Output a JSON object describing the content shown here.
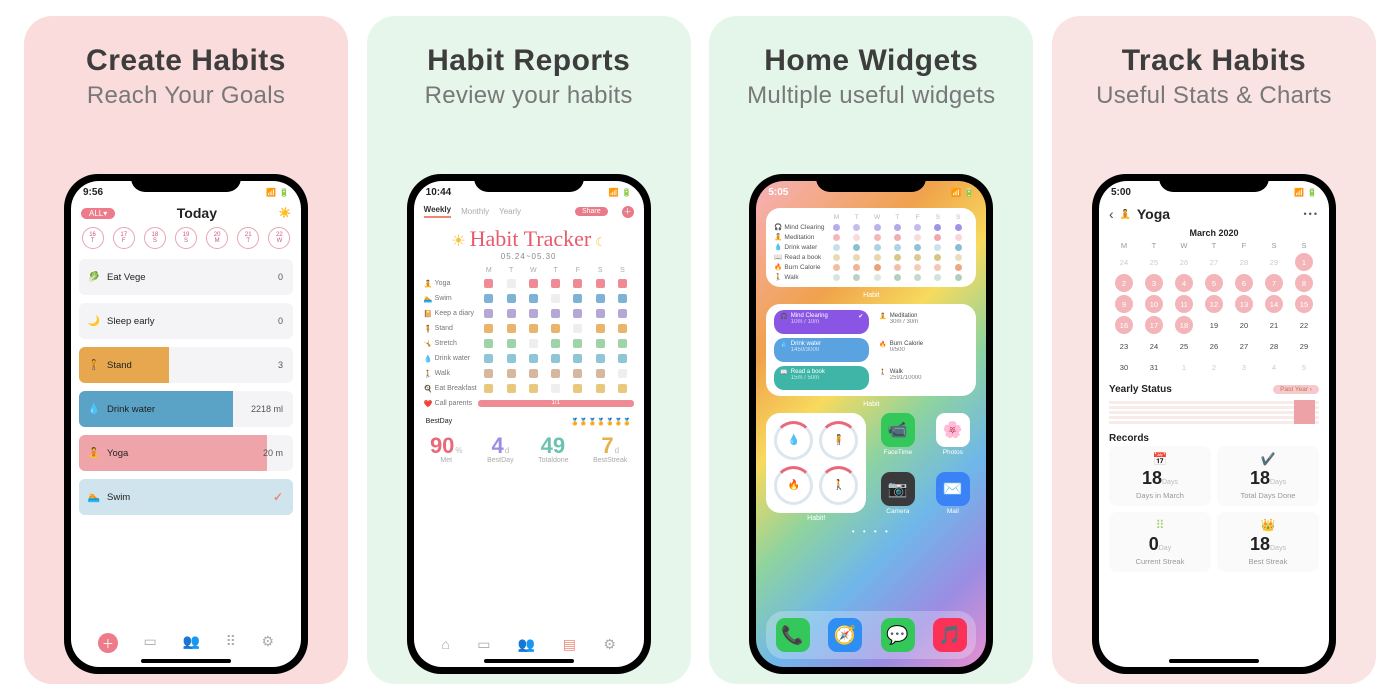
{
  "panels": [
    {
      "title": "Create Habits",
      "sub": "Reach Your Goals"
    },
    {
      "title": "Habit Reports",
      "sub": "Review your habits"
    },
    {
      "title": "Home Widgets",
      "sub": "Multiple useful widgets"
    },
    {
      "title": "Track Habits",
      "sub": "Useful Stats & Charts"
    }
  ],
  "p1": {
    "clock": "9:56",
    "filter": "ALL▾",
    "header": "Today",
    "dates": [
      {
        "n": "16",
        "d": "T"
      },
      {
        "n": "17",
        "d": "F"
      },
      {
        "n": "18",
        "d": "S"
      },
      {
        "n": "19",
        "d": "S"
      },
      {
        "n": "20",
        "d": "M"
      },
      {
        "n": "21",
        "d": "T"
      },
      {
        "n": "22",
        "d": "W"
      }
    ],
    "items": [
      {
        "icon": "🥬",
        "name": "Eat Vege",
        "val": "0",
        "fill": 0,
        "color": "#f4f4f7"
      },
      {
        "icon": "🌙",
        "name": "Sleep early",
        "val": "0",
        "fill": 0,
        "color": "#f4f4f7"
      },
      {
        "icon": "🧍",
        "name": "Stand",
        "val": "3",
        "fill": 42,
        "color": "#e6a74f"
      },
      {
        "icon": "💧",
        "name": "Drink water",
        "val": "2218 ml",
        "fill": 72,
        "color": "#5aa2c6"
      },
      {
        "icon": "🧘",
        "name": "Yoga",
        "val": "20 m",
        "fill": 88,
        "color": "#efa4aa"
      },
      {
        "icon": "🏊",
        "name": "Swim",
        "check": true,
        "fill": 100,
        "color": "#cfe4ec"
      }
    ]
  },
  "p2": {
    "clock": "10:44",
    "tabs": [
      "Weekly",
      "Monthly",
      "Yearly"
    ],
    "active_tab": 0,
    "share": "Share",
    "hero_title": "Habit Tracker",
    "hero_dates": "05.24~05.30",
    "days": [
      "M",
      "T",
      "W",
      "T",
      "F",
      "S",
      "S"
    ],
    "rows": [
      {
        "icon": "🧘",
        "name": "Yoga",
        "color": "#ef8b95",
        "cells": [
          1,
          0,
          1,
          1,
          1,
          1,
          1
        ]
      },
      {
        "icon": "🏊",
        "name": "Swim",
        "color": "#7fb3d5",
        "cells": [
          1,
          1,
          1,
          0,
          1,
          1,
          1
        ]
      },
      {
        "icon": "📔",
        "name": "Keep a diary",
        "color": "#b7a7d6",
        "cells": [
          1,
          1,
          1,
          1,
          1,
          1,
          1
        ]
      },
      {
        "icon": "🧍",
        "name": "Stand",
        "color": "#e9b56c",
        "cells": [
          1,
          1,
          1,
          1,
          0,
          1,
          1
        ]
      },
      {
        "icon": "🤸",
        "name": "Stretch",
        "color": "#9fd3a8",
        "cells": [
          1,
          1,
          0,
          1,
          1,
          1,
          1
        ]
      },
      {
        "icon": "💧",
        "name": "Drink water",
        "color": "#8cc6d7",
        "cells": [
          1,
          1,
          1,
          1,
          1,
          1,
          1
        ]
      },
      {
        "icon": "🚶",
        "name": "Walk",
        "color": "#d7b89f",
        "cells": [
          1,
          1,
          1,
          1,
          1,
          1,
          0
        ]
      },
      {
        "icon": "🍳",
        "name": "Eat Breakfast",
        "color": "#e9c77d",
        "cells": [
          1,
          1,
          1,
          0,
          1,
          1,
          1
        ]
      }
    ],
    "call": {
      "icon": "❤️",
      "name": "Call parents",
      "label": "1/1"
    },
    "bestday_label": "BestDay",
    "bestday_medals": 7,
    "stats": [
      {
        "n": "90",
        "u": "%",
        "l": "Met",
        "c": "#e9697a"
      },
      {
        "n": "4",
        "u": "d",
        "l": "BestDay",
        "c": "#9a8de3"
      },
      {
        "n": "49",
        "u": "",
        "l": "Totaldone",
        "c": "#6cc2b1"
      },
      {
        "n": "7",
        "u": "d",
        "l": "BestStreak",
        "c": "#e6b14a"
      }
    ]
  },
  "p3": {
    "clock": "5:05",
    "days": [
      "M",
      "T",
      "W",
      "T",
      "F",
      "S",
      "S"
    ],
    "w1_rows": [
      {
        "icon": "🎧",
        "name": "Mind Clearing",
        "color": "#9a8de3"
      },
      {
        "icon": "🧘",
        "name": "Meditation",
        "color": "#f0a7af"
      },
      {
        "icon": "💧",
        "name": "Drink water",
        "color": "#7fb9d0"
      },
      {
        "icon": "📖",
        "name": "Read a book",
        "color": "#d8c17e"
      },
      {
        "icon": "🔥",
        "name": "Burn Calorie",
        "color": "#e98b5d"
      },
      {
        "icon": "🚶",
        "name": "Walk",
        "color": "#a8c9b4"
      }
    ],
    "w1_caption": "Habit",
    "w2": [
      {
        "icon": "🎧",
        "name": "Mind Clearing",
        "sub": "10m / 10m",
        "bg": "#8a55e5",
        "done": true
      },
      {
        "icon": "🧘",
        "name": "Meditation",
        "sub": "30m / 30m",
        "bg": "#ffffff",
        "txt": "w"
      },
      {
        "icon": "💧",
        "name": "Drink water",
        "sub": "1450/3000",
        "bg": "#5aa2e0"
      },
      {
        "icon": "🔥",
        "name": "Burn Calorie",
        "sub": "0/500",
        "bg": "#ffffff",
        "txt": "w"
      },
      {
        "icon": "📖",
        "name": "Read a book",
        "sub": "15m / 50m",
        "bg": "#3fb5a8"
      },
      {
        "icon": "🚶",
        "name": "Walk",
        "sub": "2591/10000",
        "bg": "#ffffff",
        "txt": "w"
      }
    ],
    "w2_caption": "Habit",
    "ring_icons": [
      "💧",
      "🧍",
      "🔥",
      "🚶"
    ],
    "ring_caption": "Habit!",
    "apps": [
      {
        "name": "FaceTime",
        "bg": "#34c759",
        "icon": "📹"
      },
      {
        "name": "Photos",
        "bg": "#ffffff",
        "icon": "🌸"
      },
      {
        "name": "Camera",
        "bg": "#3a3a3c",
        "icon": "📷"
      },
      {
        "name": "Mail",
        "bg": "#3b82f6",
        "icon": "✉️"
      }
    ],
    "dock": [
      {
        "bg": "#34c759",
        "icon": "📞"
      },
      {
        "bg": "#2f8ef4",
        "icon": "🧭"
      },
      {
        "bg": "#34c759",
        "icon": "💬"
      },
      {
        "bg": "#fc3158",
        "icon": "🎵"
      }
    ]
  },
  "p4": {
    "clock": "5:00",
    "title": "Yoga",
    "icon": "🧘",
    "month": "March 2020",
    "dow": [
      "M",
      "T",
      "W",
      "T",
      "F",
      "S",
      "S"
    ],
    "weeks": [
      [
        {
          "n": "24",
          "s": "off"
        },
        {
          "n": "25",
          "s": "off"
        },
        {
          "n": "26",
          "s": "off"
        },
        {
          "n": "27",
          "s": "off"
        },
        {
          "n": "28",
          "s": "off"
        },
        {
          "n": "29",
          "s": "off"
        },
        {
          "n": "1",
          "s": "on"
        }
      ],
      [
        {
          "n": "2",
          "s": "on"
        },
        {
          "n": "3",
          "s": "on"
        },
        {
          "n": "4",
          "s": "on"
        },
        {
          "n": "5",
          "s": "on"
        },
        {
          "n": "6",
          "s": "on"
        },
        {
          "n": "7",
          "s": "on"
        },
        {
          "n": "8",
          "s": "on"
        }
      ],
      [
        {
          "n": "9",
          "s": "on"
        },
        {
          "n": "10",
          "s": "on"
        },
        {
          "n": "11",
          "s": "on"
        },
        {
          "n": "12",
          "s": "on"
        },
        {
          "n": "13",
          "s": "on"
        },
        {
          "n": "14",
          "s": "on"
        },
        {
          "n": "15",
          "s": "on"
        }
      ],
      [
        {
          "n": "16",
          "s": "on"
        },
        {
          "n": "17",
          "s": "on"
        },
        {
          "n": "18",
          "s": "on"
        },
        {
          "n": "19",
          "s": ""
        },
        {
          "n": "20",
          "s": ""
        },
        {
          "n": "21",
          "s": ""
        },
        {
          "n": "22",
          "s": ""
        }
      ],
      [
        {
          "n": "23",
          "s": ""
        },
        {
          "n": "24",
          "s": ""
        },
        {
          "n": "25",
          "s": ""
        },
        {
          "n": "26",
          "s": ""
        },
        {
          "n": "27",
          "s": ""
        },
        {
          "n": "28",
          "s": ""
        },
        {
          "n": "29",
          "s": ""
        }
      ],
      [
        {
          "n": "30",
          "s": ""
        },
        {
          "n": "31",
          "s": ""
        },
        {
          "n": "1",
          "s": "off"
        },
        {
          "n": "2",
          "s": "off"
        },
        {
          "n": "3",
          "s": "off"
        },
        {
          "n": "4",
          "s": "off"
        },
        {
          "n": "5",
          "s": "off"
        }
      ]
    ],
    "yearly_label": "Yearly Status",
    "yearly_pill": "Past Year ›",
    "records_label": "Records",
    "cards": [
      {
        "icon": "📅",
        "iconColor": "#e9697a",
        "n": "18",
        "u": "Days",
        "l": "Days in March"
      },
      {
        "icon": "✔️",
        "iconColor": "#5cc08f",
        "n": "18",
        "u": "Days",
        "l": "Total Days Done"
      },
      {
        "icon": "⠿",
        "iconColor": "#9ed06a",
        "n": "0",
        "u": "Day",
        "l": "Current Streak"
      },
      {
        "icon": "👑",
        "iconColor": "#f3c84b",
        "n": "18",
        "u": "Days",
        "l": "Best Streak"
      }
    ]
  }
}
